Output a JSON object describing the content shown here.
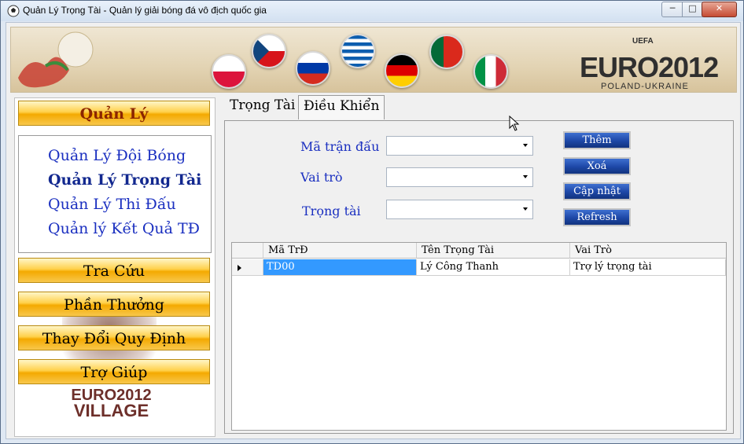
{
  "window": {
    "title": "Quản Lý Trọng Tài - Quản lý giải bóng đá vô địch quốc gia",
    "min_label": "─",
    "max_label": "□",
    "close_label": "✕"
  },
  "banner": {
    "uefa": "UEFA",
    "logo": "EURO2012",
    "subtitle": "POLAND-UKRAINE"
  },
  "sidebar": {
    "main_button": "Quản Lý",
    "submenu": [
      {
        "label": "Quản Lý Đội Bóng",
        "active": false
      },
      {
        "label": "Quản Lý Trọng Tài",
        "active": true
      },
      {
        "label": "Quản Lý Thi Đấu",
        "active": false
      },
      {
        "label": "Quản lý Kết Quả TĐ",
        "active": false
      }
    ],
    "buttons": [
      "Tra Cứu",
      "Phần Thưởng",
      "Thay Đổi Quy Định",
      "Trợ Giúp"
    ],
    "village_logo": [
      "EURO2012",
      "VILLAGE"
    ]
  },
  "tabs": [
    {
      "label": "Trọng Tài",
      "selected": false
    },
    {
      "label": "Điều Khiển",
      "selected": true
    }
  ],
  "form": {
    "fields": [
      {
        "label": "Mã trận đấu",
        "value": ""
      },
      {
        "label": "Vai trò",
        "value": ""
      },
      {
        "label": "Trọng tài",
        "value": ""
      }
    ],
    "actions": [
      "Thêm",
      "Xoá",
      "Cập nhật",
      "Refresh"
    ]
  },
  "grid": {
    "columns": [
      "Mã TrĐ",
      "Tên Trọng Tài",
      "Vai Trò"
    ],
    "rows": [
      [
        "TD00",
        "Lý Công Thanh",
        "Trợ lý trọng tài"
      ]
    ]
  },
  "colors": {
    "accent_blue": "#1a2fc0",
    "button_gold": "#f4a900",
    "selection": "#3399ff"
  }
}
